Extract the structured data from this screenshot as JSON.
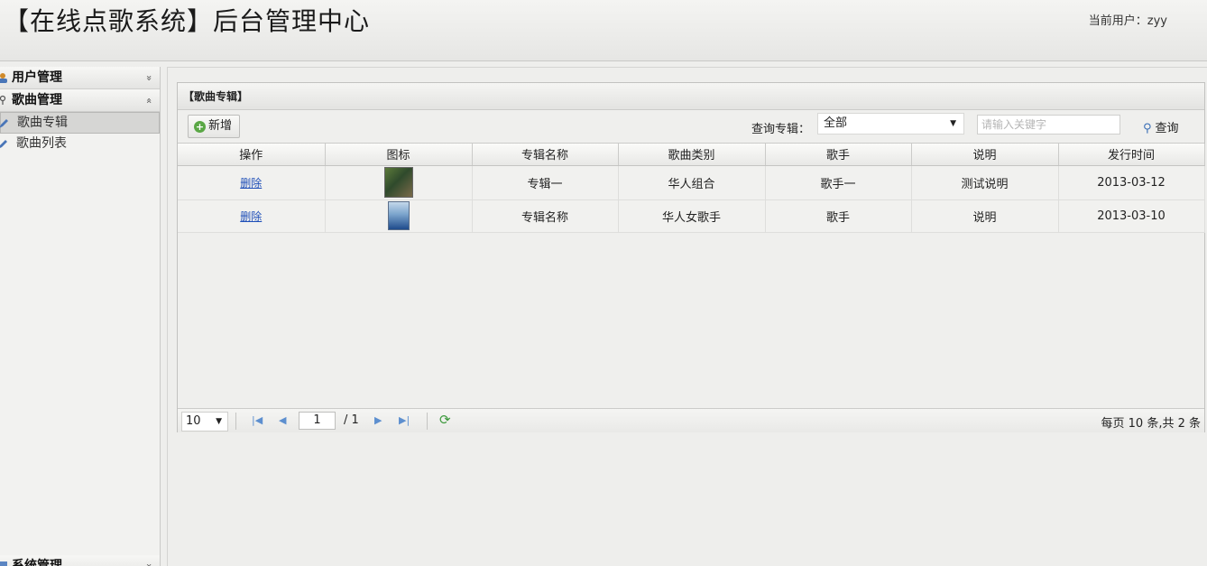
{
  "header": {
    "title": "【在线点歌系统】后台管理中心",
    "current_user": "当前用户：zyy"
  },
  "sidebar": {
    "sections": [
      {
        "label": "用户管理",
        "state": "collapsed",
        "chevron": "»"
      },
      {
        "label": "歌曲管理",
        "state": "expanded",
        "chevron": "«"
      },
      {
        "label": "系统管理",
        "state": "collapsed",
        "chevron": "»"
      }
    ],
    "items": [
      {
        "label": "歌曲专辑",
        "active": true
      },
      {
        "label": "歌曲列表",
        "active": false
      }
    ]
  },
  "panel": {
    "title": "【歌曲专辑】",
    "add_label": "新增",
    "query_label": "查询专辑：",
    "query_select": "全部",
    "search_placeholder": "请输入关键字",
    "search_label": "查询"
  },
  "table": {
    "columns": [
      "操作",
      "图标",
      "专辑名称",
      "歌曲类别",
      "歌手",
      "说明",
      "发行时间"
    ],
    "rows": [
      {
        "action": "删除",
        "icon": "album-cover-green",
        "name": "专辑一",
        "category": "华人组合",
        "singer": "歌手一",
        "note": "测试说明",
        "date": "2013-03-12"
      },
      {
        "action": "删除",
        "icon": "album-cover-blue",
        "name": "专辑名称",
        "category": "华人女歌手",
        "singer": "歌手",
        "note": "说明",
        "date": "2013-03-10"
      }
    ]
  },
  "pager": {
    "page_size": "10",
    "current_page": "1",
    "total_pages": "/ 1",
    "info": "每页 10 条,共 2 条"
  },
  "colors": {
    "accent": "#3b6fb6",
    "link": "#1f4fb8",
    "add_green": "#5aa745"
  }
}
